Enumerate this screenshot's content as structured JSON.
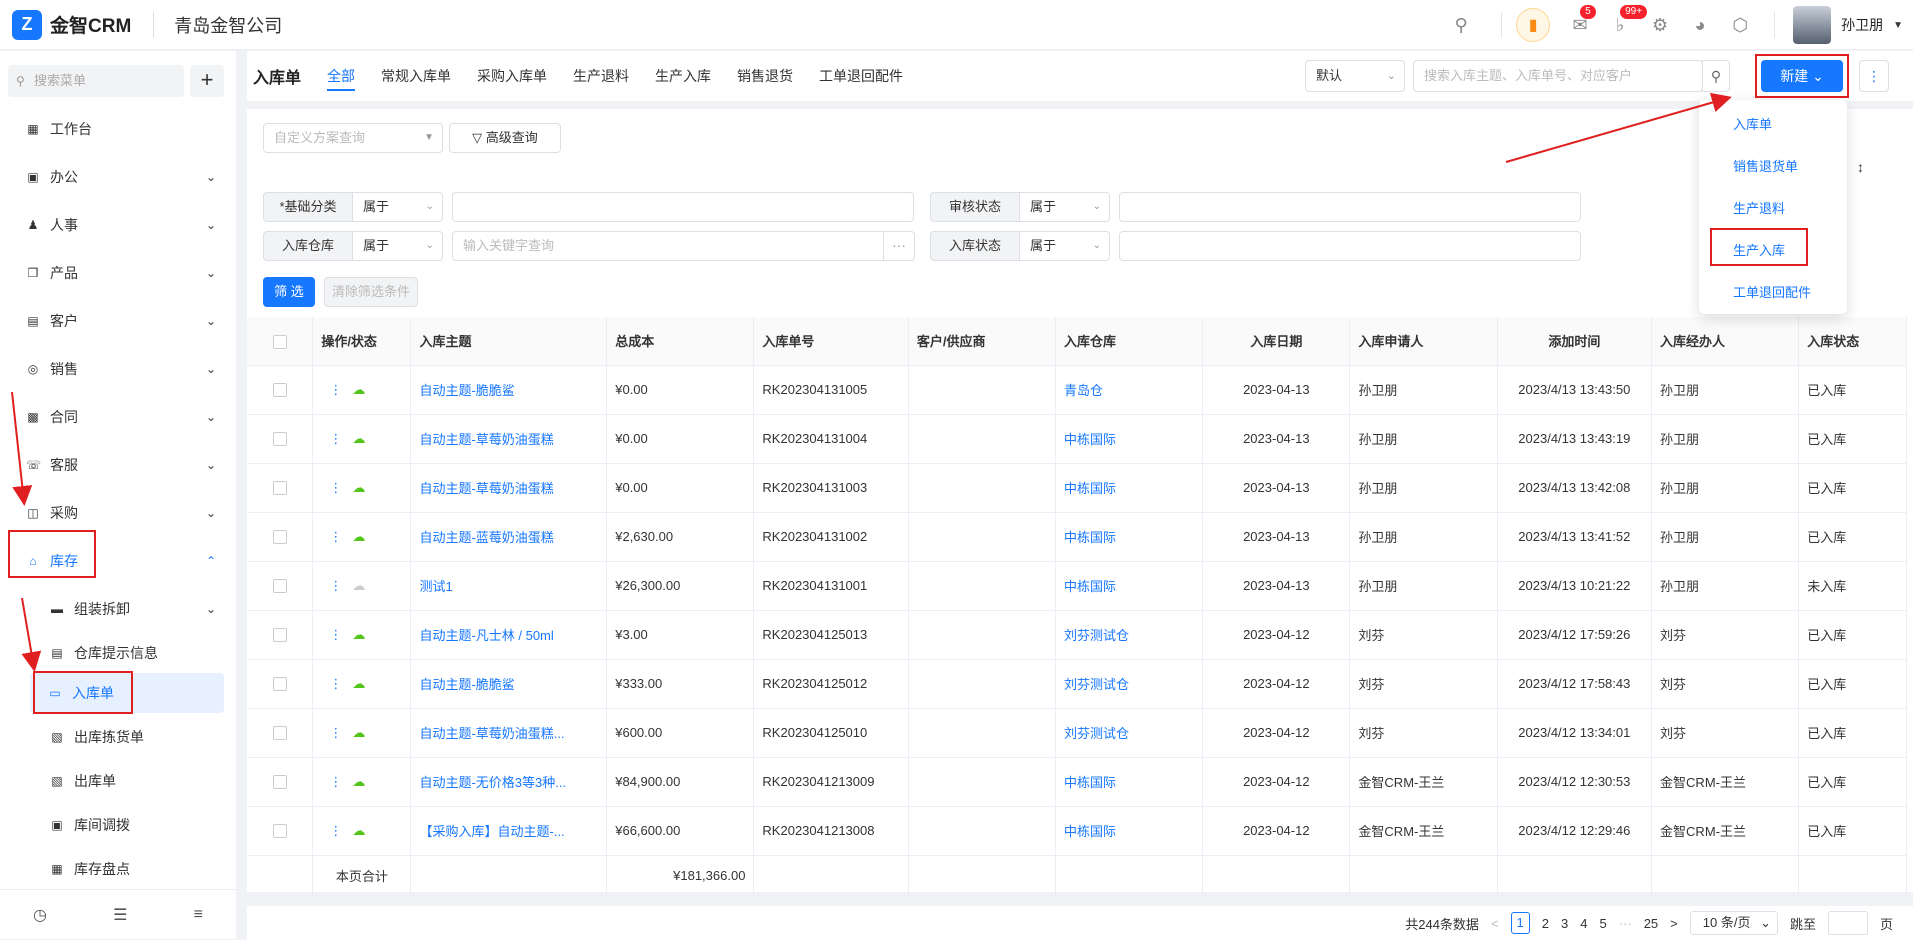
{
  "topbar": {
    "app_name": "金智CRM",
    "company": "青岛金智公司",
    "mail_badge": "5",
    "bell_badge": "99+",
    "user_name": "孙卫朋"
  },
  "sidebar": {
    "search_placeholder": "搜索菜单",
    "items": [
      {
        "label": "工作台",
        "icon": "dashboard-icon"
      },
      {
        "label": "办公",
        "icon": "office-icon"
      },
      {
        "label": "人事",
        "icon": "people-icon"
      },
      {
        "label": "产品",
        "icon": "box-icon"
      },
      {
        "label": "客户",
        "icon": "building-icon"
      },
      {
        "label": "销售",
        "icon": "sales-icon"
      },
      {
        "label": "合同",
        "icon": "contract-icon"
      },
      {
        "label": "客服",
        "icon": "headset-icon"
      },
      {
        "label": "采购",
        "icon": "bag-icon"
      },
      {
        "label": "库存",
        "icon": "warehouse-icon"
      }
    ],
    "subitems": [
      {
        "label": "组装拆卸",
        "icon": "folder-icon"
      },
      {
        "label": "仓库提示信息",
        "icon": "doc-icon"
      },
      {
        "label": "入库单",
        "icon": "inbound-icon"
      },
      {
        "label": "出库拣货单",
        "icon": "outbound-pick-icon"
      },
      {
        "label": "出库单",
        "icon": "outbound-icon"
      },
      {
        "label": "库间调拨",
        "icon": "transfer-icon"
      },
      {
        "label": "库存盘点",
        "icon": "inventory-icon"
      }
    ]
  },
  "header": {
    "title": "入库单",
    "tabs": [
      "全部",
      "常规入库单",
      "采购入库单",
      "生产退料",
      "生产入库",
      "销售退货",
      "工单退回配件"
    ],
    "view_select": "默认",
    "search_placeholder": "搜索入库主题、入库单号、对应客户",
    "new_button": "新建"
  },
  "filter": {
    "scheme_placeholder": "自定义方案查询",
    "advanced_label": "高级查询",
    "rows": [
      {
        "label": "*基础分类",
        "op": "属于",
        "placeholder": ""
      },
      {
        "label": "审核状态",
        "op": "属于",
        "placeholder": ""
      },
      {
        "label": "入库仓库",
        "op": "属于",
        "placeholder": "输入关键字查询"
      },
      {
        "label": "入库状态",
        "op": "属于",
        "placeholder": ""
      }
    ],
    "filter_button": "筛 选",
    "clear_button": "清除筛选条件"
  },
  "dropdown": {
    "items": [
      "入库单",
      "销售退货单",
      "生产退料",
      "生产入库",
      "工单退回配件"
    ]
  },
  "table": {
    "columns": [
      "操作/状态",
      "入库主题",
      "总成本",
      "入库单号",
      "客户/供应商",
      "入库仓库",
      "入库日期",
      "入库申请人",
      "添加时间",
      "入库经办人",
      "入库状态"
    ],
    "rows": [
      {
        "subject": "自动主题-脆脆鲨",
        "cost": "¥0.00",
        "no": "RK202304131005",
        "customer": "",
        "warehouse": "青岛仓",
        "date": "2023-04-13",
        "applicant": "孙卫朋",
        "added": "2023/4/13 13:43:50",
        "handler": "孙卫朋",
        "status": "已入库"
      },
      {
        "subject": "自动主题-草莓奶油蛋糕",
        "cost": "¥0.00",
        "no": "RK202304131004",
        "customer": "",
        "warehouse": "中栋国际",
        "date": "2023-04-13",
        "applicant": "孙卫朋",
        "added": "2023/4/13 13:43:19",
        "handler": "孙卫朋",
        "status": "已入库"
      },
      {
        "subject": "自动主题-草莓奶油蛋糕",
        "cost": "¥0.00",
        "no": "RK202304131003",
        "customer": "",
        "warehouse": "中栋国际",
        "date": "2023-04-13",
        "applicant": "孙卫朋",
        "added": "2023/4/13 13:42:08",
        "handler": "孙卫朋",
        "status": "已入库"
      },
      {
        "subject": "自动主题-蓝莓奶油蛋糕",
        "cost": "¥2,630.00",
        "no": "RK202304131002",
        "customer": "",
        "warehouse": "中栋国际",
        "date": "2023-04-13",
        "applicant": "孙卫朋",
        "added": "2023/4/13 13:41:52",
        "handler": "孙卫朋",
        "status": "已入库"
      },
      {
        "subject": "测试1",
        "cost": "¥26,300.00",
        "no": "RK202304131001",
        "customer": "",
        "warehouse": "中栋国际",
        "date": "2023-04-13",
        "applicant": "孙卫朋",
        "added": "2023/4/13 10:21:22",
        "handler": "孙卫朋",
        "status": "未入库"
      },
      {
        "subject": "自动主题-凡士林 / 50ml",
        "cost": "¥3.00",
        "no": "RK202304125013",
        "customer": "",
        "warehouse": "刘芬测试仓",
        "date": "2023-04-12",
        "applicant": "刘芬",
        "added": "2023/4/12 17:59:26",
        "handler": "刘芬",
        "status": "已入库"
      },
      {
        "subject": "自动主题-脆脆鲨",
        "cost": "¥333.00",
        "no": "RK202304125012",
        "customer": "",
        "warehouse": "刘芬测试仓",
        "date": "2023-04-12",
        "applicant": "刘芬",
        "added": "2023/4/12 17:58:43",
        "handler": "刘芬",
        "status": "已入库"
      },
      {
        "subject": "自动主题-草莓奶油蛋糕...",
        "cost": "¥600.00",
        "no": "RK202304125010",
        "customer": "",
        "warehouse": "刘芬测试仓",
        "date": "2023-04-12",
        "applicant": "刘芬",
        "added": "2023/4/12 13:34:01",
        "handler": "刘芬",
        "status": "已入库"
      },
      {
        "subject": "自动主题-无价格3等3种...",
        "cost": "¥84,900.00",
        "no": "RK2023041213009",
        "customer": "",
        "warehouse": "中栋国际",
        "date": "2023-04-12",
        "applicant": "金智CRM-王兰",
        "added": "2023/4/12 12:30:53",
        "handler": "金智CRM-王兰",
        "status": "已入库"
      },
      {
        "subject": "【采购入库】自动主题-...",
        "cost": "¥66,600.00",
        "no": "RK2023041213008",
        "customer": "",
        "warehouse": "中栋国际",
        "date": "2023-04-12",
        "applicant": "金智CRM-王兰",
        "added": "2023/4/12 12:29:46",
        "handler": "金智CRM-王兰",
        "status": "已入库"
      }
    ],
    "summary_label": "本页合计",
    "summary_total": "¥181,366.00"
  },
  "pager": {
    "total": "共244条数据",
    "pages": [
      "1",
      "2",
      "3",
      "4",
      "5",
      "···",
      "25"
    ],
    "page_size": "10 条/页",
    "jump_label": "跳至",
    "page_suffix": "页"
  },
  "colors": {
    "accent": "#1677ff",
    "annotation": "#e02020",
    "success": "#52c41a"
  }
}
